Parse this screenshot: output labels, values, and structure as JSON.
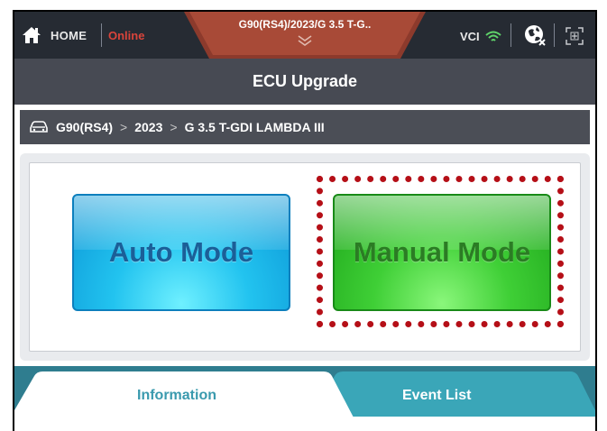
{
  "status_bar": {
    "home_label": "HOME",
    "connection_status": "Online",
    "vehicle_title": "G90(RS4)/2023/G 3.5 T-G..",
    "vci_label": "VCI",
    "icons": [
      "home-icon",
      "expand-chevron-icon",
      "wifi-icon",
      "globe-icon",
      "fit-screen-icon"
    ]
  },
  "page_title": "ECU Upgrade",
  "breadcrumb": {
    "icon": "car-icon",
    "items": [
      "G90(RS4)",
      "2023",
      "G 3.5 T-GDI LAMBDA III"
    ],
    "separator": ">"
  },
  "modes": {
    "auto_label": "Auto Mode",
    "manual_label": "Manual Mode",
    "highlighted": "Manual Mode"
  },
  "tabs": [
    {
      "label": "Information",
      "active": true
    },
    {
      "label": "Event List",
      "active": false
    }
  ],
  "colors": {
    "status_bar_bg": "#262b33",
    "title_bar_bg": "#474a53",
    "online_red": "#d9443b",
    "auto_blue": "#22c3ef",
    "manual_green": "#3fcf36",
    "highlight_red": "#b50f17",
    "tab_teal": "#3aa6b8"
  }
}
